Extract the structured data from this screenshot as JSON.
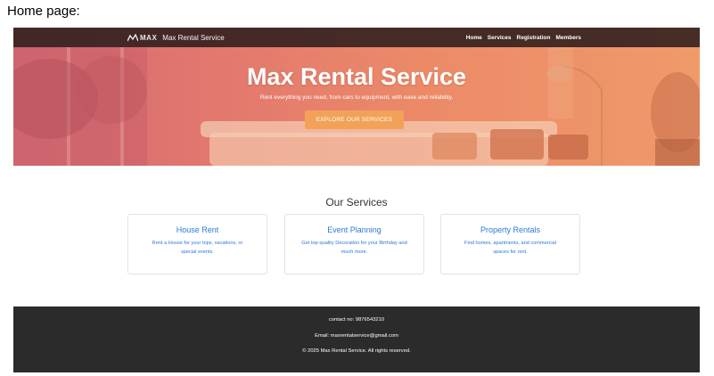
{
  "caption": "Home page:",
  "navbar": {
    "logo_text": "MAX",
    "brand_name": "Max Rental Service",
    "links": [
      "Home",
      "Services",
      "Registration",
      "Members"
    ]
  },
  "hero": {
    "title": "Max Rental Service",
    "subtitle": "Rent everything you need, from cars to equipment, with ease and reliability.",
    "cta_label": "EXPLORE OUR SERVICES"
  },
  "services": {
    "heading": "Our Services",
    "cards": [
      {
        "title": "House Rent",
        "description": "Rent a House for your trips, vacations, or special events."
      },
      {
        "title": "Event Planning",
        "description": "Get top-quality Decoration for your Birthday and much more."
      },
      {
        "title": "Property Rentals",
        "description": "Find homes, apartments, and commercial spaces for rent."
      }
    ]
  },
  "footer": {
    "contact": "contact no: 9876543210",
    "email": "Email: maxrentalservice@gmail.com",
    "copyright": "© 2025 Max Rental Service. All rights reserved."
  },
  "colors": {
    "accent_button": "#f2a258",
    "card_text": "#2a78d6",
    "footer_bg": "#2b2b2b",
    "navbar_bg": "#2d1e1c"
  }
}
